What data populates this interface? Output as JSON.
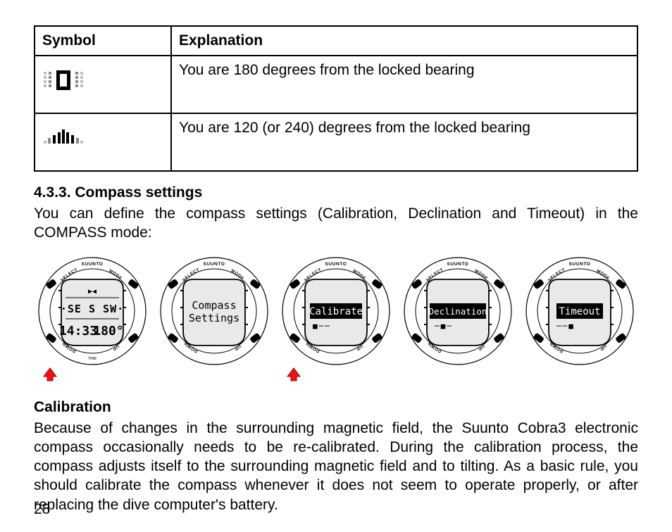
{
  "table": {
    "head": {
      "symbol": "Symbol",
      "explanation": "Explanation"
    },
    "rows": [
      {
        "explanation": "You are 180 degrees from the locked bearing"
      },
      {
        "explanation": "You are 120 (or 240) degrees from the locked bearing"
      }
    ]
  },
  "section433": {
    "title": "4.3.3. Compass settings",
    "intro": "You can define the compass settings (Calibration, Declination and Timeout) in the COMPASS mode:"
  },
  "watches": {
    "brand": "SUUNTO",
    "buttons": {
      "select": "SELECT",
      "mode": "MODE",
      "down": "DOWN",
      "up": "UP"
    },
    "time_label": "TIME",
    "screen1": {
      "top_markers": "▶◀",
      "row": "·SE S SW·",
      "time": "14:33",
      "bearing": "180°"
    },
    "screen2": {
      "line1": "Compass",
      "line2": "Settings"
    },
    "screen3": {
      "label": "Calibrate",
      "dots": "■──"
    },
    "screen4": {
      "label": "Declination",
      "dots": "─■─"
    },
    "screen5": {
      "label": "Timeout",
      "dots": "──■"
    }
  },
  "calibration": {
    "title": "Calibration",
    "text": "Because of changes in the surrounding magnetic field, the Suunto Cobra3 electronic compass occasionally needs to be re-calibrated. During the calibration process, the compass adjusts itself to the surrounding magnetic field and to tilting. As a basic rule, you should calibrate the compass whenever it does not seem to operate properly, or after replacing the dive computer's battery."
  },
  "page_number": "28"
}
